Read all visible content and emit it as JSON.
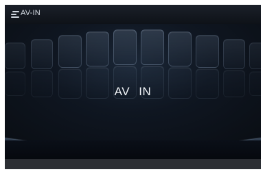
{
  "header": {
    "title": "AV-IN",
    "menu_icon": "menu-lines-icon"
  },
  "main": {
    "mode_label": "AV   IN"
  },
  "colors": {
    "background": "#0b0f15",
    "header": "#1b2029",
    "footer": "#2b2e33",
    "text": "#f2f5f8"
  }
}
